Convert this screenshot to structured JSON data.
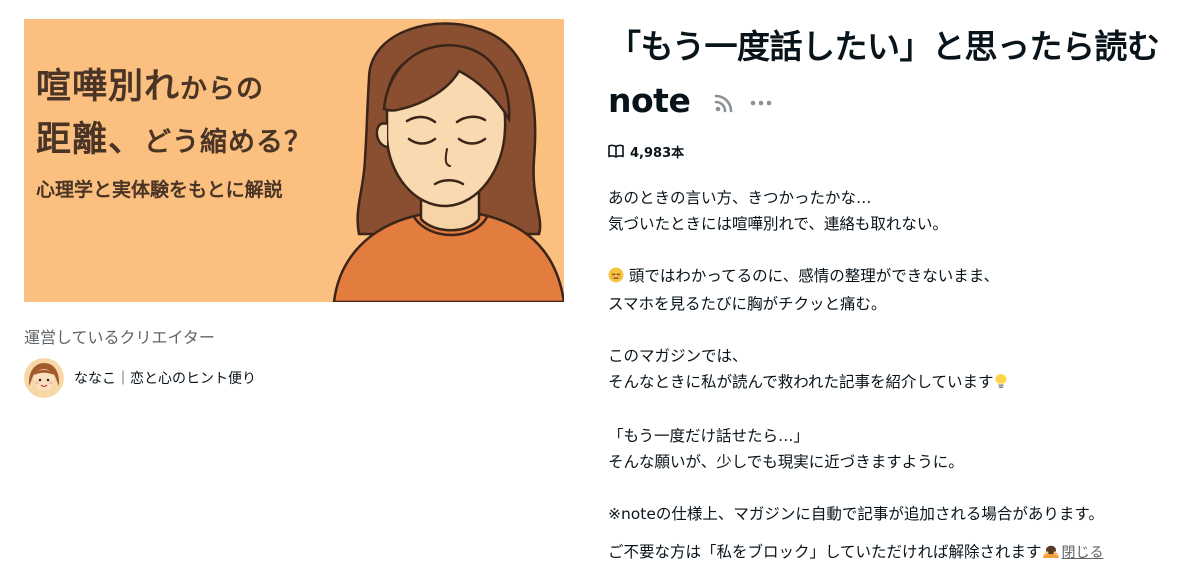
{
  "banner": {
    "line1_main": "喧嘩別れ",
    "line1_small": "からの",
    "line2_main": "距離、",
    "line2_small": "どう縮める？",
    "line3": "心理学と実体験をもとに解説"
  },
  "creator_section": {
    "label": "運営しているクリエイター",
    "name": "ななこ｜恋と心のヒント便り"
  },
  "magazine": {
    "title": "「もう一度話したい」と思ったら読むnote",
    "note_count": "4,983本",
    "description": {
      "p1_line1": "あのときの言い方、きつかったかな…",
      "p1_line2": "気づいたときには喧嘩別れで、連絡も取れない。",
      "p2_line1": " 頭ではわかってるのに、感情の整理ができないまま、",
      "p2_line2": "スマホを見るたびに胸がチクッと痛む。",
      "p3_line1": "このマガジンでは、",
      "p3_line2": "そんなときに私が読んで救われた記事を紹介しています",
      "p4_line1": "「もう一度だけ話せたら…」",
      "p4_line2": "そんな願いが、少しでも現実に近づきますように。",
      "p5": "※noteの仕様上、マガジンに自動で記事が追加される場合があります。",
      "p6": "ご不要な方は「私をブロック」していただければ解除されます",
      "close_label": "閉じる"
    }
  },
  "icons": {
    "rss": "rss-icon",
    "more": "more-icon",
    "book": "book-icon"
  },
  "colors": {
    "banner_bg": "#fbc07f",
    "text": "#08131a",
    "muted": "#5f6468"
  }
}
